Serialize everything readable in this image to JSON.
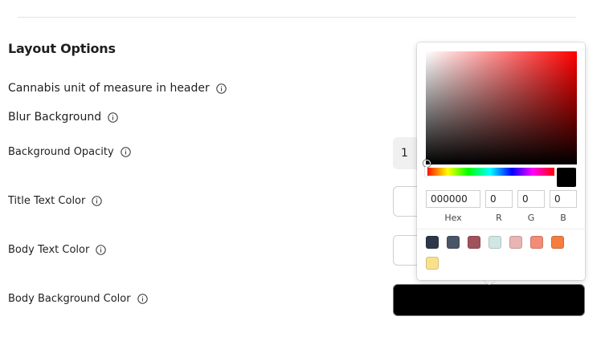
{
  "section": {
    "title": "Layout Options"
  },
  "rows": [
    {
      "label": "Cannabis unit of measure in header"
    },
    {
      "label": "Blur Background"
    },
    {
      "label": "Background Opacity",
      "value": "1"
    },
    {
      "label": "Title Text Color"
    },
    {
      "label": "Body Text Color"
    },
    {
      "label": "Body Background Color",
      "color": "#000000"
    }
  ],
  "picker": {
    "hex": "000000",
    "r": "0",
    "g": "0",
    "b": "0",
    "labels": {
      "hex": "Hex",
      "r": "R",
      "g": "G",
      "b": "B"
    },
    "presets": [
      "#2d3748",
      "#4a5568",
      "#a0525c",
      "#cfe6e3",
      "#e9b4b4",
      "#f48b76",
      "#f57d3f",
      "#fbe08c"
    ]
  },
  "colors": {
    "divider": "#e3e3e3",
    "opacity_bg": "#f0f0f0",
    "selected_color": "#000000"
  }
}
